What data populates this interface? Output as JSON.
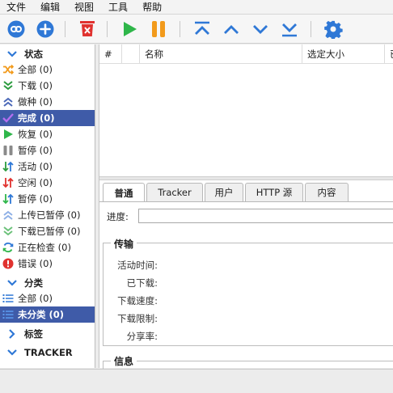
{
  "menu": [
    "文件",
    "编辑",
    "视图",
    "工具",
    "帮助"
  ],
  "toolbar": {
    "icons": [
      "link-icon",
      "add-icon",
      "delete-icon",
      "resume-icon",
      "pause-icon",
      "move-top-icon",
      "move-up-icon",
      "move-down-icon",
      "move-bottom-icon",
      "settings-icon"
    ],
    "colors": {
      "blue": "#2f78d6",
      "red": "#e0322f",
      "green": "#2fb64a",
      "orange": "#f29a1b"
    }
  },
  "sidebar": {
    "status_header": "状态",
    "status_items": [
      {
        "label": "全部 (0)",
        "icon": "shuffle-icon"
      },
      {
        "label": "下载 (0)",
        "icon": "download-icon"
      },
      {
        "label": "做种 (0)",
        "icon": "seed-icon"
      },
      {
        "label": "完成 (0)",
        "icon": "check-icon"
      },
      {
        "label": "恢复 (0)",
        "icon": "play-icon"
      },
      {
        "label": "暂停 (0)",
        "icon": "pause-icon"
      },
      {
        "label": "活动 (0)",
        "icon": "active-icon"
      },
      {
        "label": "空闲 (0)",
        "icon": "inactive-icon"
      },
      {
        "label": "暂停 (0)",
        "icon": "stalled-icon"
      },
      {
        "label": "上传已暂停 (0)",
        "icon": "upload-paused-icon"
      },
      {
        "label": "下载已暂停 (0)",
        "icon": "download-paused-icon"
      },
      {
        "label": "正在检查 (0)",
        "icon": "checking-icon"
      },
      {
        "label": "错误 (0)",
        "icon": "error-icon"
      }
    ],
    "category_header": "分类",
    "category_items": [
      {
        "label": "全部 (0)",
        "icon": "list-icon"
      },
      {
        "label": "未分类 (0)",
        "icon": "list-icon"
      }
    ],
    "tags_header": "标签",
    "tracker_header": "TRACKER",
    "selected_color": "#3f5ba8"
  },
  "table": {
    "columns": [
      "#",
      "名称",
      "选定大小",
      "已"
    ]
  },
  "details": {
    "tabs": [
      "普通",
      "Tracker",
      "用户",
      "HTTP 源",
      "内容"
    ],
    "progress_label": "进度:",
    "transfer_legend": "传输",
    "transfer_fields": [
      "活动时间:",
      "已下载:",
      "下载速度:",
      "下载限制:",
      "分享率:"
    ],
    "info_legend": "信息"
  }
}
